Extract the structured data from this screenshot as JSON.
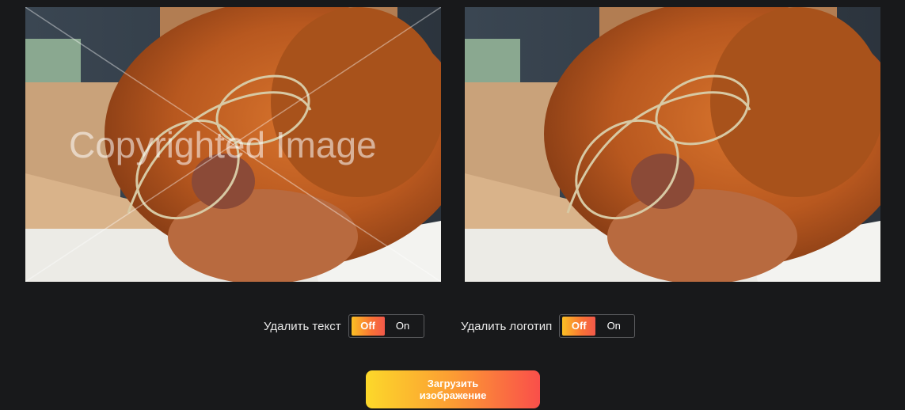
{
  "images": {
    "original": {
      "watermark_text": "Copyrighted Image"
    },
    "result": {}
  },
  "controls": {
    "remove_text": {
      "label": "Удалить текст",
      "off": "Off",
      "on": "On",
      "state": "Off"
    },
    "remove_logo": {
      "label": "Удалить логотип",
      "off": "Off",
      "on": "On",
      "state": "Off"
    }
  },
  "upload_button": {
    "label": "Загрузить изображение"
  },
  "colors": {
    "background": "#18191b",
    "accent_start": "#fcd82a",
    "accent_end": "#f94f4a"
  }
}
